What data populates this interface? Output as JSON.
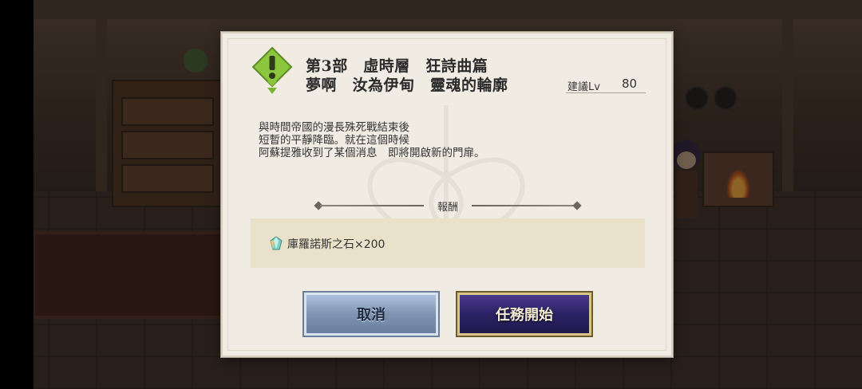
{
  "dialog": {
    "title_line1": "第3部　虛時層　狂詩曲篇",
    "title_line2": "夢啊　汝為伊甸　靈魂的輪廓",
    "recommended_label": "建議Lv",
    "recommended_level": "80",
    "description": [
      "與時間帝國的漫長殊死戰結束後",
      "短暫的平靜降臨。就在這個時候",
      "阿蘇提雅收到了某個消息　即將開啟新的門扉。"
    ],
    "reward_header": "報酬",
    "reward_item": "庫羅諾斯之石×200",
    "cancel_label": "取消",
    "start_label": "任務開始"
  },
  "colors": {
    "dialog_bg": "#f0ece3",
    "reward_bg": "#e9e1c9",
    "alert_green": "#8cc63f",
    "cancel_button": "#8aa0c0",
    "start_button": "#2b2266"
  },
  "icons": {
    "alert": "exclamation-diamond-icon",
    "reward": "gem-icon"
  }
}
